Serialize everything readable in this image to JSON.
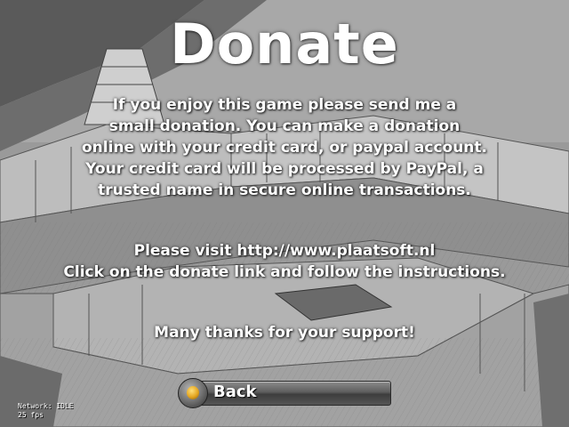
{
  "screen": {
    "title": "Donate"
  },
  "body": {
    "intro_lines": [
      "If you enjoy this game please send me a",
      "small donation. You can make a donation",
      "online with your credit card, or paypal account.",
      "Your credit card will be processed by PayPal, a",
      "trusted name in secure online transactions."
    ],
    "visit_lines": [
      "Please visit http://www.plaatsoft.nl",
      "Click on the donate link and follow the instructions."
    ],
    "thanks": "Many thanks for your support!"
  },
  "back_button": {
    "label": "Back",
    "icon": "gold-orb-icon"
  },
  "status": {
    "network": "Network: IDLE",
    "fps": "25 fps"
  },
  "colors": {
    "text": "#ffffff",
    "background": "#8a8a8a",
    "button_bar": "#5e5e5e",
    "button_orb": "#e4a520"
  }
}
